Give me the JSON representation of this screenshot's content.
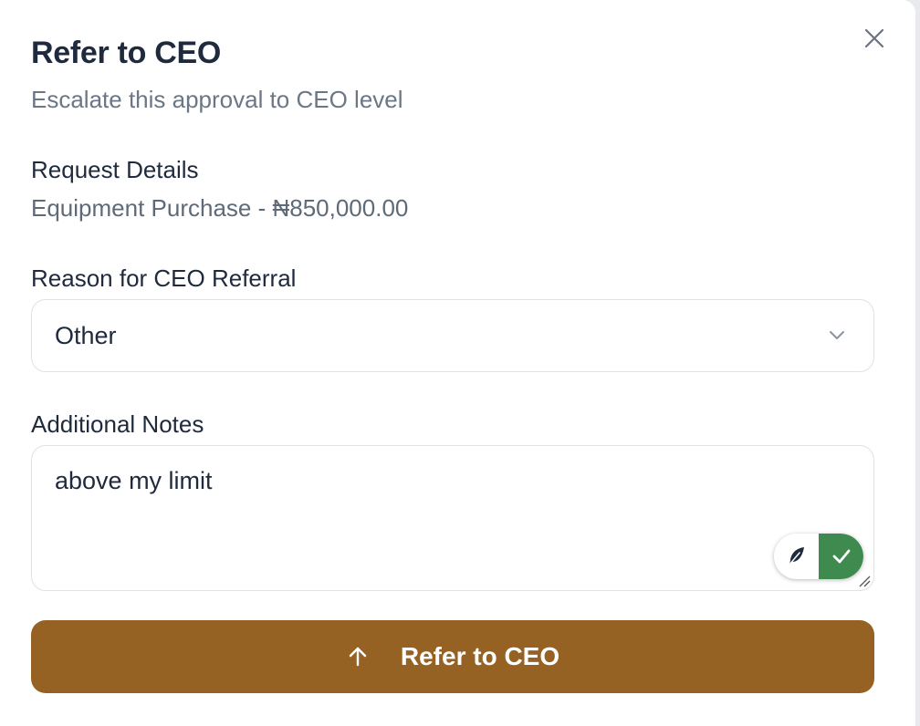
{
  "dialog": {
    "title": "Refer to CEO",
    "subtitle": "Escalate this approval to CEO level",
    "close_icon": "close-icon"
  },
  "request": {
    "label": "Request Details",
    "value": "Equipment Purchase - ₦850,000.00"
  },
  "reason": {
    "label": "Reason for CEO Referral",
    "selected": "Other",
    "icon": "chevron-down-icon"
  },
  "notes": {
    "label": "Additional Notes",
    "value": "above my limit",
    "assist_icons": [
      "feather-icon",
      "check-icon"
    ]
  },
  "submit": {
    "label": "Refer to CEO",
    "icon": "arrow-up-icon",
    "color": "#956223"
  },
  "colors": {
    "accent": "#956223",
    "assist_green": "#3f8a4f",
    "text_primary": "#1f2a3d",
    "text_muted": "#6b7686"
  }
}
